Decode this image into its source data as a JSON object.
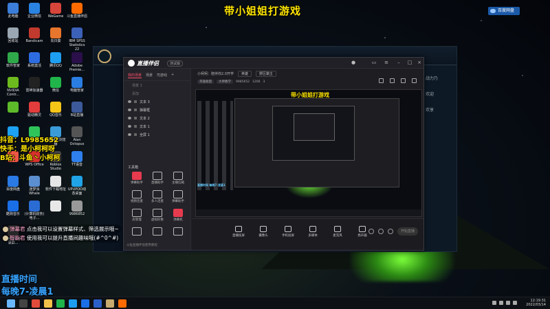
{
  "stream_title": "带小姐姐打游戏",
  "top_badge": "百度网盘",
  "desktop_icons": [
    {
      "label": "此电脑",
      "color": "#3b7dd8"
    },
    {
      "label": "企业微信",
      "color": "#2a83e0"
    },
    {
      "label": "WeGame",
      "color": "#d8453a"
    },
    {
      "label": "斗鱼直播伴侣",
      "color": "#ff6a00"
    },
    {
      "label": "回收站",
      "color": "#9aa6b2"
    },
    {
      "label": "Bandicam",
      "color": "#c23a2e"
    },
    {
      "label": "向日葵",
      "color": "#e8762c"
    },
    {
      "label": "IBM SPSS Statistics 22",
      "color": "#3b62b8"
    },
    {
      "label": "软件管家",
      "color": "#2fa84a"
    },
    {
      "label": "系统激活",
      "color": "#2d6ce0"
    },
    {
      "label": "腾讯QQ",
      "color": "#1e9ef0"
    },
    {
      "label": "Adobe Premie...",
      "color": "#2a0f4a"
    },
    {
      "label": "NVIDIA Contr...",
      "color": "#6dba1e"
    },
    {
      "label": "雷神加速器",
      "color": "#222"
    },
    {
      "label": "微信",
      "color": "#21b44b"
    },
    {
      "label": "电脑管家",
      "color": "#2a7de1"
    },
    {
      "label": "",
      "color": "#5dbb2a"
    },
    {
      "label": "驱动精灵",
      "color": "#e23c3c"
    },
    {
      "label": "QQ音乐",
      "color": "#f5c518"
    },
    {
      "label": "B站直播",
      "color": "#3c5a9a"
    },
    {
      "label": "",
      "color": "#1da1f2"
    },
    {
      "label": "",
      "color": "#2ec45a"
    },
    {
      "label": "360极速浏览器",
      "color": "#3a9bd8"
    },
    {
      "label": "Alan Octopus",
      "color": "#555"
    },
    {
      "label": "",
      "color": "#e54"
    },
    {
      "label": "WPS Office",
      "color": "#d8312b"
    },
    {
      "label": "Roblox Studio",
      "color": "#444"
    },
    {
      "label": "TT语音",
      "color": "#2f80ed"
    },
    {
      "label": "百度网盘",
      "color": "#2a79e4"
    },
    {
      "label": "迷梦派 Whale",
      "color": "#5b8fcf"
    },
    {
      "label": "软件下载地址",
      "color": "#e6e6e6"
    },
    {
      "label": "UPUPOO动态桌面",
      "color": "#21a3e8"
    },
    {
      "label": "酷狗音乐",
      "color": "#1a6ee6"
    },
    {
      "label": "(计算机财务)电子...",
      "color": "#2b6cd4"
    },
    {
      "label": "",
      "color": "#e8e8e8"
    },
    {
      "label": "9986852",
      "color": "#999"
    },
    {
      "label": "Bonfrontm... 录屏...",
      "color": "#3d3d3d"
    }
  ],
  "overlay": {
    "douyin": "抖音：L9985652",
    "kuaishou": "快手：是小柯柯呀",
    "bilibili": "B站：斗鱼丶小柯柯",
    "comments": [
      {
        "name": "弹幕君",
        "text": "点击我可以设置弹幕样式、筛选展示哦~"
      },
      {
        "name": "智能君",
        "text": "使用我可以提升直播间趣味哦(#^0^#)"
      }
    ],
    "bottom_lines": [
      "直播时间",
      "每晚7-凌晨1"
    ]
  },
  "lol_client": {
    "side_lines": [
      "",
      "战力乃",
      "",
      "欢迎",
      "",
      "欢享"
    ]
  },
  "obs": {
    "app_name": "直播伴侣",
    "version_tag": "测试版",
    "tabs": [
      "我的场景",
      "场景",
      "司游戏",
      "+"
    ],
    "layers": [
      {
        "label": "文本 3"
      },
      {
        "label": "弹幕框"
      },
      {
        "label": "文本 2"
      },
      {
        "label": "文本 1"
      },
      {
        "label": "全屏 1"
      }
    ],
    "scene_group": {
      "label1": "场景 1",
      "label2": "添加"
    },
    "tools_title": "工具箱",
    "tools": [
      {
        "label": "弹幕助手",
        "hot": true
      },
      {
        "label": "直播助手",
        "hot": false
      },
      {
        "label": "主播信箱",
        "hot": false
      },
      {
        "label": "视频连麦",
        "hot": false
      },
      {
        "label": "多人连麦",
        "hot": false
      },
      {
        "label": "弹幕助手",
        "hot": false
      },
      {
        "label": "房管理",
        "hot": false
      },
      {
        "label": "虚拟形象",
        "hot": false
      },
      {
        "label": "弹幕机",
        "hot": true
      },
      {
        "label": "",
        "hot": false
      },
      {
        "label": "",
        "hot": false
      },
      {
        "label": "",
        "hot": false
      }
    ],
    "footer": "斗鱼直播伴侣使用教程",
    "scene_row": {
      "title": "小柯柯：陪伴你2.0开学",
      "cat": "英雄",
      "edit": "野区霸主"
    },
    "stats_row": {
      "a": "英雄联盟",
      "b": "大神教学",
      "rid": "9985652",
      "fans": "1206",
      "viewers": "3"
    },
    "preview_title": "带小姐姐打游戏",
    "preview_cyan": "直播时间 每晚7-凌晨1",
    "bottom_buttons": [
      "直播投屏",
      "摄像头",
      "手机投屏",
      "多媒体",
      "麦克风",
      "扬声器"
    ],
    "start_label": "开始直播"
  },
  "clock": {
    "time": "12:19:31",
    "date": "2022/03/14"
  },
  "taskbar_icons": [
    {
      "name": "windows-icon",
      "color": "#6ab7ff"
    },
    {
      "name": "search-icon",
      "color": "#444"
    },
    {
      "name": "chrome-icon",
      "color": "#e04b3a"
    },
    {
      "name": "folder-icon",
      "color": "#f4c24a"
    },
    {
      "name": "wechat-icon",
      "color": "#21b44b"
    },
    {
      "name": "qq-icon",
      "color": "#1e9ef0"
    },
    {
      "name": "music-icon",
      "color": "#1a6ee6"
    },
    {
      "name": "word-icon",
      "color": "#2b5fc8"
    },
    {
      "name": "game-icon",
      "color": "#c8aa6e"
    },
    {
      "name": "douyu-icon",
      "color": "#ff6a00"
    }
  ]
}
